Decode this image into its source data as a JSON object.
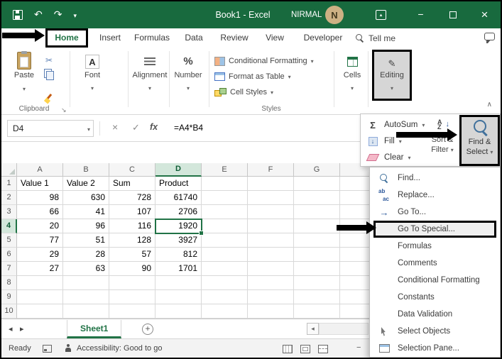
{
  "window": {
    "title": "Book1 - Excel",
    "user_name": "NIRMAL",
    "avatar_initial": "N"
  },
  "tabs": {
    "items": [
      "Home",
      "Insert",
      "Formulas",
      "Data",
      "Review",
      "View",
      "Developer"
    ],
    "active": "Home",
    "tell_me": "Tell me"
  },
  "ribbon": {
    "paste_label": "Paste",
    "clipboard_label": "Clipboard",
    "font_label": "Font",
    "alignment_label": "Alignment",
    "number_label": "Number",
    "conditional_formatting_label": "Conditional Formatting",
    "format_as_table_label": "Format as Table",
    "cell_styles_label": "Cell Styles",
    "styles_label": "Styles",
    "cells_label": "Cells",
    "editing_label": "Editing"
  },
  "formula_bar": {
    "name_box": "D4",
    "function_symbol": "fx",
    "formula": "=A4*B4"
  },
  "editing_panel": {
    "autosum_label": "AutoSum",
    "fill_label": "Fill",
    "clear_label": "Clear",
    "sort_line1": "Sort &",
    "sort_line2": "Filter",
    "find_line1": "Find &",
    "find_line2": "Select"
  },
  "find_select_menu": {
    "items": [
      {
        "label": "Find...",
        "icon": "magnifier-icon",
        "highlight": false
      },
      {
        "label": "Replace...",
        "icon": "replace-icon",
        "highlight": false
      },
      {
        "label": "Go To...",
        "icon": "goto-icon",
        "highlight": false
      },
      {
        "label": "Go To Special...",
        "icon": "",
        "highlight": true
      },
      {
        "label": "Formulas",
        "icon": "",
        "highlight": false
      },
      {
        "label": "Comments",
        "icon": "",
        "highlight": false
      },
      {
        "label": "Conditional Formatting",
        "icon": "",
        "highlight": false
      },
      {
        "label": "Constants",
        "icon": "",
        "highlight": false
      },
      {
        "label": "Data Validation",
        "icon": "",
        "highlight": false
      },
      {
        "label": "Select Objects",
        "icon": "cursor-icon",
        "highlight": false
      },
      {
        "label": "Selection Pane...",
        "icon": "pane-icon",
        "highlight": false
      }
    ]
  },
  "grid": {
    "columns": [
      "A",
      "B",
      "C",
      "D",
      "E",
      "F",
      "G"
    ],
    "row_numbers": [
      "1",
      "2",
      "3",
      "4",
      "5",
      "6",
      "7",
      "8",
      "9",
      "10"
    ],
    "selected_cell": "D4",
    "rows": [
      {
        "cells": [
          "Value 1",
          "Value 2",
          "Sum",
          "Product"
        ]
      },
      {
        "cells": [
          "98",
          "630",
          "728",
          "61740"
        ]
      },
      {
        "cells": [
          "66",
          "41",
          "107",
          "2706"
        ]
      },
      {
        "cells": [
          "20",
          "96",
          "116",
          "1920"
        ]
      },
      {
        "cells": [
          "77",
          "51",
          "128",
          "3927"
        ]
      },
      {
        "cells": [
          "29",
          "28",
          "57",
          "812"
        ]
      },
      {
        "cells": [
          "27",
          "63",
          "90",
          "1701"
        ]
      },
      {
        "cells": []
      },
      {
        "cells": []
      },
      {
        "cells": []
      }
    ]
  },
  "sheet_bar": {
    "sheet_name": "Sheet1"
  },
  "status_bar": {
    "ready": "Ready",
    "accessibility": "Accessibility: Good to go"
  },
  "colors": {
    "excel_green": "#217346",
    "titlebar_green": "#186a3e",
    "selection": "#217346"
  }
}
